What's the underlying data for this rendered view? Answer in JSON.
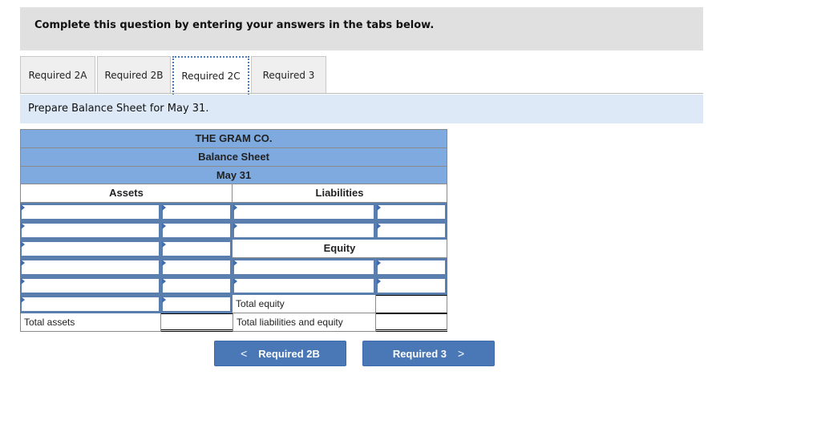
{
  "instructions": "Complete this question by entering your answers in the tabs below.",
  "tabs": [
    {
      "label": "Required 2A",
      "active": false
    },
    {
      "label": "Required 2B",
      "active": false
    },
    {
      "label": "Required 2C",
      "active": true
    },
    {
      "label": "Required 3",
      "active": false
    }
  ],
  "prompt": "Prepare Balance Sheet for May 31.",
  "sheet": {
    "company": "THE GRAM CO.",
    "title": "Balance Sheet",
    "date": "May 31",
    "assets_header": "Assets",
    "liabilities_header": "Liabilities",
    "equity_header": "Equity",
    "total_equity_label": "Total equity",
    "total_assets_label": "Total assets",
    "total_liabilities_equity_label": "Total liabilities and equity",
    "asset_rows": [
      {
        "account": "",
        "amount": ""
      },
      {
        "account": "",
        "amount": ""
      },
      {
        "account": "",
        "amount": ""
      },
      {
        "account": "",
        "amount": ""
      },
      {
        "account": "",
        "amount": ""
      },
      {
        "account": "",
        "amount": ""
      }
    ],
    "liability_rows": [
      {
        "account": "",
        "amount": ""
      },
      {
        "account": "",
        "amount": ""
      }
    ],
    "equity_rows": [
      {
        "account": "",
        "amount": ""
      },
      {
        "account": "",
        "amount": ""
      }
    ],
    "total_assets": "",
    "total_equity": "",
    "total_liabilities_and_equity": ""
  },
  "nav": {
    "prev_label": "Required 2B",
    "next_label": "Required 3",
    "prev_icon": "chevron-left-icon",
    "next_icon": "chevron-right-icon"
  },
  "colors": {
    "header_blue": "#7eaadf",
    "button_blue": "#4a78b6",
    "prompt_bg": "#dde9f6",
    "input_border": "#5a7fae"
  }
}
